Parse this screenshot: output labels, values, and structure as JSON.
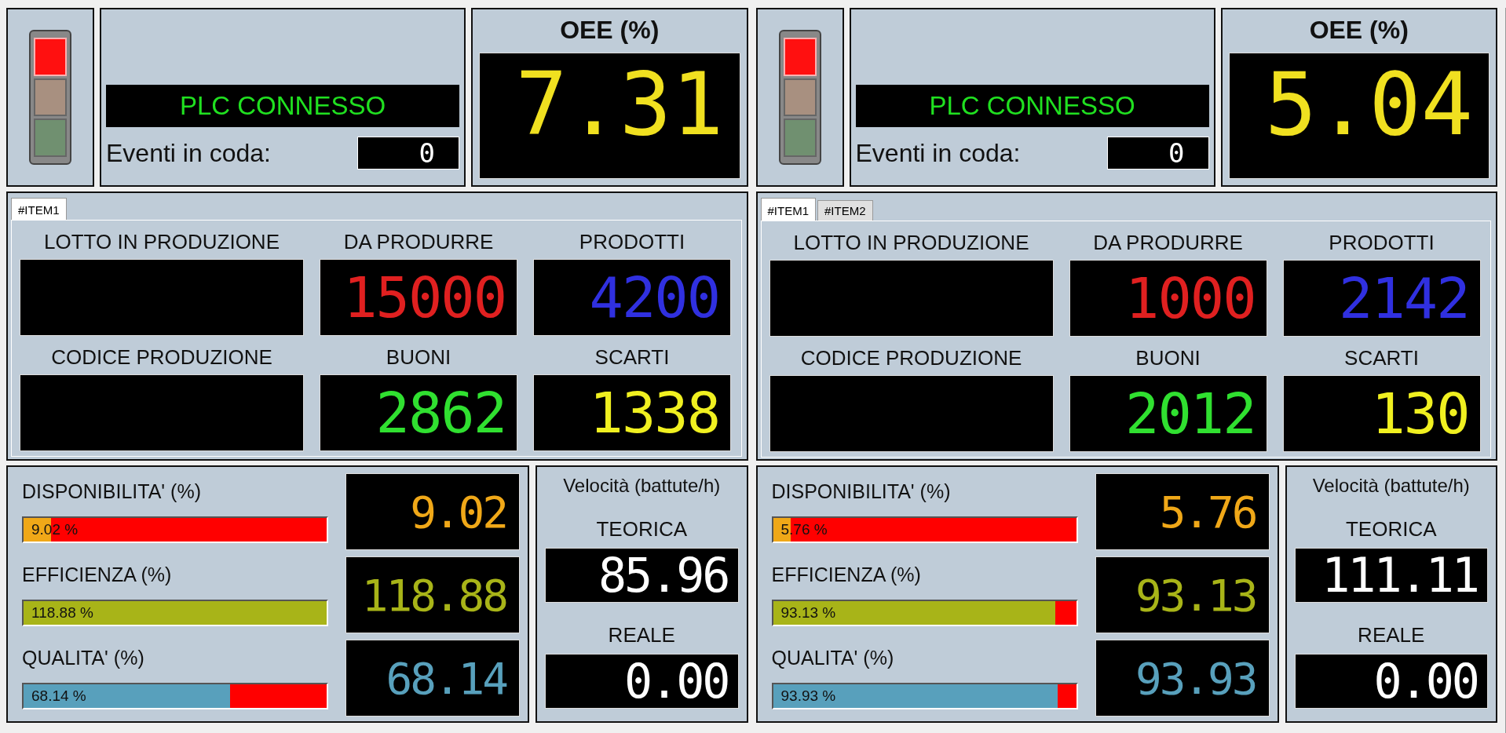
{
  "stations": [
    {
      "tower": [
        {
          "color": "#ff1010",
          "on": true
        },
        {
          "color": "#a89080",
          "on": false
        },
        {
          "color": "#709070",
          "on": false
        }
      ],
      "status": "PLC CONNESSO",
      "queue_label": "Eventi in coda:",
      "queue_value": "0",
      "oee": {
        "title": "OEE (%)",
        "value": "7.31"
      },
      "tabs": [
        {
          "label": "#ITEM1",
          "selected": true
        }
      ],
      "fields": [
        {
          "label": "LOTTO IN PRODUZIONE",
          "kind": "text"
        },
        {
          "label": "DA PRODURRE",
          "kind": "counter",
          "value": "15000",
          "color": "#e02020"
        },
        {
          "label": "PRODOTTI",
          "kind": "counter",
          "value": "4200",
          "color": "#3030e0"
        },
        {
          "label": "CODICE PRODUZIONE",
          "kind": "text"
        },
        {
          "label": "BUONI",
          "kind": "counter",
          "value": "2862",
          "color": "#30e030"
        },
        {
          "label": "SCARTI",
          "kind": "counter",
          "value": "1338",
          "color": "#f0f020"
        }
      ],
      "metrics": [
        {
          "label": "DISPONIBILITA' (%)",
          "bar_text": "9.02 %",
          "level": 0.0902,
          "value": "9.02",
          "color": "#f0a818"
        },
        {
          "label": "EFFICIENZA (%)",
          "bar_text": "118.88 %",
          "level": 1,
          "value": "118.88",
          "color": "#a8b418"
        },
        {
          "label": "QUALITA' (%)",
          "bar_text": "68.14 %",
          "level": 0.6814,
          "value": "68.14",
          "color": "#58a0bc"
        }
      ],
      "speed": {
        "title": "Velocità (battute/h)",
        "items": [
          {
            "label": "TEORICA",
            "value": "85.96"
          },
          {
            "label": "REALE",
            "value": "0.00"
          }
        ]
      }
    },
    {
      "tower": [
        {
          "color": "#ff1010",
          "on": true
        },
        {
          "color": "#a89080",
          "on": false
        },
        {
          "color": "#709070",
          "on": false
        }
      ],
      "status": "PLC CONNESSO",
      "queue_label": "Eventi in coda:",
      "queue_value": "0",
      "oee": {
        "title": "OEE (%)",
        "value": "5.04"
      },
      "tabs": [
        {
          "label": "#ITEM1",
          "selected": true
        },
        {
          "label": "#ITEM2",
          "selected": false
        }
      ],
      "fields": [
        {
          "label": "LOTTO IN PRODUZIONE",
          "kind": "text"
        },
        {
          "label": "DA PRODURRE",
          "kind": "counter",
          "value": "1000",
          "color": "#e02020"
        },
        {
          "label": "PRODOTTI",
          "kind": "counter",
          "value": "2142",
          "color": "#3030e0"
        },
        {
          "label": "CODICE PRODUZIONE",
          "kind": "text"
        },
        {
          "label": "BUONI",
          "kind": "counter",
          "value": "2012",
          "color": "#30e030"
        },
        {
          "label": "SCARTI",
          "kind": "counter",
          "value": "130",
          "color": "#f0f020"
        }
      ],
      "metrics": [
        {
          "label": "DISPONIBILITA' (%)",
          "bar_text": "5.76 %",
          "level": 0.0576,
          "value": "5.76",
          "color": "#f0a818"
        },
        {
          "label": "EFFICIENZA (%)",
          "bar_text": "93.13 %",
          "level": 0.9313,
          "value": "93.13",
          "color": "#a8b418"
        },
        {
          "label": "QUALITA' (%)",
          "bar_text": "93.93 %",
          "level": 0.9393,
          "value": "93.93",
          "color": "#58a0bc"
        }
      ],
      "speed": {
        "title": "Velocità (battute/h)",
        "items": [
          {
            "label": "TEORICA",
            "value": "111.11"
          },
          {
            "label": "REALE",
            "value": "0.00"
          }
        ]
      }
    }
  ]
}
